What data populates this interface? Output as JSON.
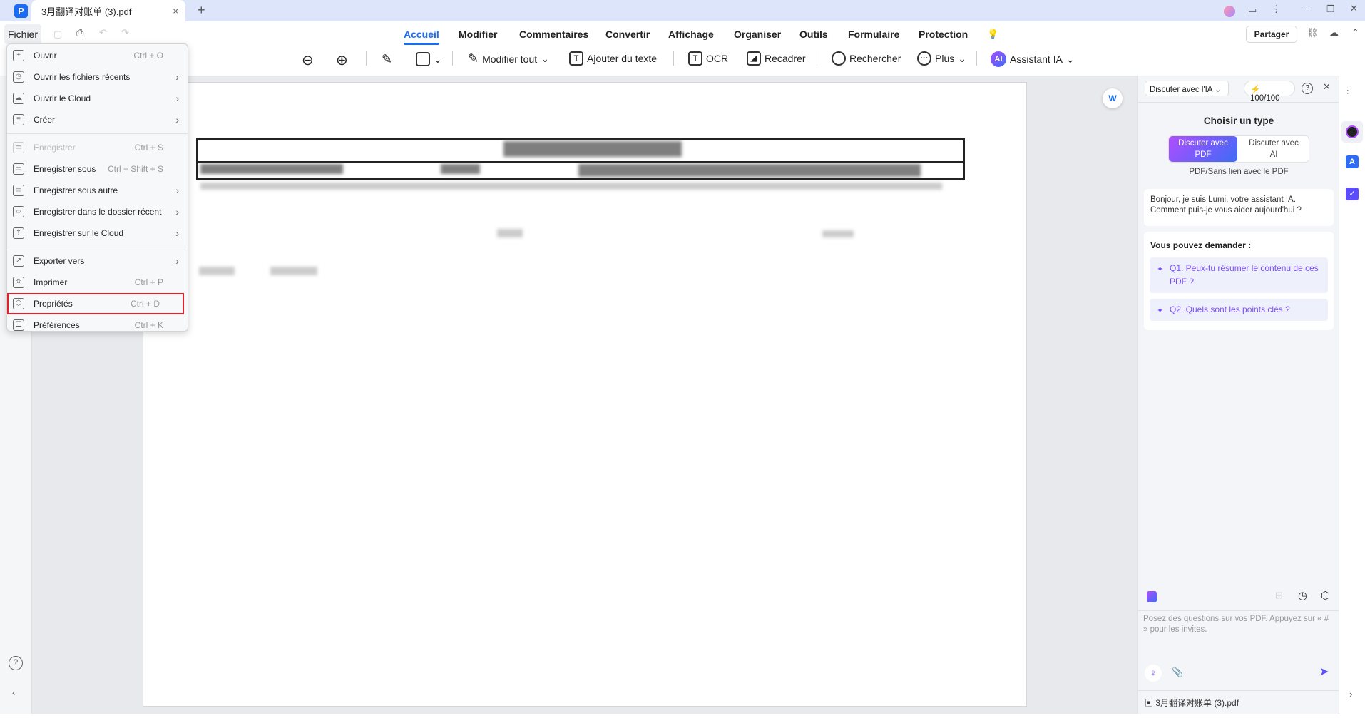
{
  "tab": {
    "title": "3月翻译对账单 (3).pdf",
    "close": "×",
    "new": "+"
  },
  "menubar": {
    "file": "Fichier",
    "tabs": [
      "Accueil",
      "Modifier",
      "Commentaires",
      "Convertir",
      "Affichage",
      "Organiser",
      "Outils",
      "Formulaire",
      "Protection"
    ],
    "active_tab": "Accueil",
    "share": "Partager"
  },
  "toolbar": {
    "edit_all": "Modifier tout",
    "add_text": "Ajouter du texte",
    "ocr": "OCR",
    "crop": "Recadrer",
    "search": "Rechercher",
    "more": "Plus",
    "ai_assistant": "Assistant IA",
    "ai_badge": "AI"
  },
  "file_menu": {
    "items": [
      {
        "label": "Ouvrir",
        "shortcut": "Ctrl + O",
        "icon": "plus-icon"
      },
      {
        "label": "Ouvrir les fichiers récents",
        "submenu": true,
        "icon": "clock-icon"
      },
      {
        "label": "Ouvrir le Cloud",
        "submenu": true,
        "icon": "cloud-icon"
      },
      {
        "label": "Créer",
        "submenu": true,
        "icon": "create-icon"
      },
      {
        "label": "Enregistrer",
        "shortcut": "Ctrl + S",
        "disabled": true,
        "icon": "save-icon"
      },
      {
        "label": "Enregistrer sous",
        "shortcut": "Ctrl + Shift + S",
        "icon": "save-as-icon"
      },
      {
        "label": "Enregistrer sous autre",
        "submenu": true,
        "icon": "save-as-icon"
      },
      {
        "label": "Enregistrer dans le dossier récent",
        "submenu": true,
        "icon": "folder-icon"
      },
      {
        "label": "Enregistrer sur le Cloud",
        "submenu": true,
        "icon": "cloud-upload-icon"
      },
      {
        "label": "Exporter vers",
        "submenu": true,
        "icon": "export-icon"
      },
      {
        "label": "Imprimer",
        "shortcut": "Ctrl + P",
        "icon": "print-icon"
      },
      {
        "label": "Propriétés",
        "shortcut": "Ctrl + D",
        "highlighted": true,
        "icon": "properties-icon"
      },
      {
        "label": "Préférences",
        "shortcut": "Ctrl + K",
        "icon": "sliders-icon"
      }
    ]
  },
  "ai_panel": {
    "mode_select": "Discuter avec l'IA",
    "credits": "100/100",
    "choose_type": "Choisir un type",
    "type_pdf": "Discuter avec PDF",
    "type_ai": "Discuter avec AI",
    "type_hint": "PDF/Sans lien avec le PDF",
    "greeting": "Bonjour, je suis Lumi, votre assistant IA. Comment puis-je vous aider aujourd'hui ?",
    "ask_title": "Vous pouvez demander :",
    "questions": [
      "Q1. Peux-tu résumer le contenu de ces PDF ?",
      "Q2. Quels sont les points clés ?"
    ],
    "input_placeholder": "Posez des questions sur vos PDF. Appuyez sur « # » pour les invites.",
    "file_name": "3月翻译对账单 (3).pdf"
  },
  "colors": {
    "accent": "#1a6cf5",
    "ai_purple": "#7c4dff",
    "highlight": "#e0202a"
  }
}
